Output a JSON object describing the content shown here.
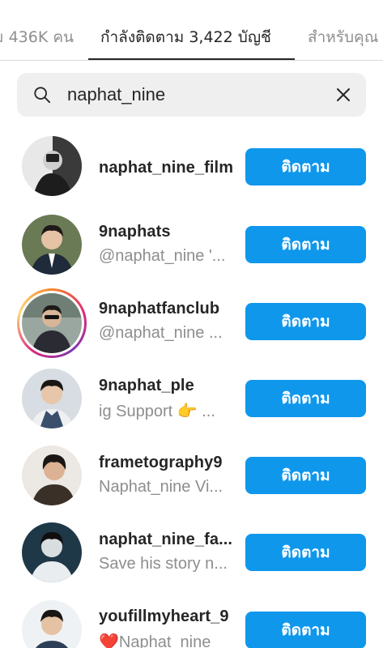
{
  "tabs": {
    "left_label": "ม 436K คน",
    "active_label": "กำลังติดตาม 3,422 บัญชี",
    "right_label": "สำหรับคุณ"
  },
  "search": {
    "value": "naphat_nine",
    "search_icon": "search-icon",
    "clear_icon": "close-icon"
  },
  "accounts": [
    {
      "username": "naphat_nine_film",
      "subtitle": "",
      "follow_label": "ติดตาม",
      "has_story": false
    },
    {
      "username": "9naphats",
      "subtitle": "@naphat_nine '...",
      "follow_label": "ติดตาม",
      "has_story": false
    },
    {
      "username": "9naphatfanclub",
      "subtitle": "@naphat_nine ...",
      "follow_label": "ติดตาม",
      "has_story": true
    },
    {
      "username": "9naphat_ple",
      "subtitle": "ig Support 👉 ...",
      "follow_label": "ติดตาม",
      "has_story": false
    },
    {
      "username": "frametography9",
      "subtitle": "Naphat_nine Vi...",
      "follow_label": "ติดตาม",
      "has_story": false
    },
    {
      "username": "naphat_nine_fa...",
      "subtitle": "Save his story n...",
      "follow_label": "ติดตาม",
      "has_story": false
    },
    {
      "username": "youfillmyheart_9",
      "subtitle": "❤️Naphat_nine",
      "follow_label": "ติดตาม",
      "has_story": false
    }
  ],
  "colors": {
    "follow_button": "#0f97ec",
    "secondary_text": "#8e8e8e",
    "search_bg": "#efefef"
  }
}
